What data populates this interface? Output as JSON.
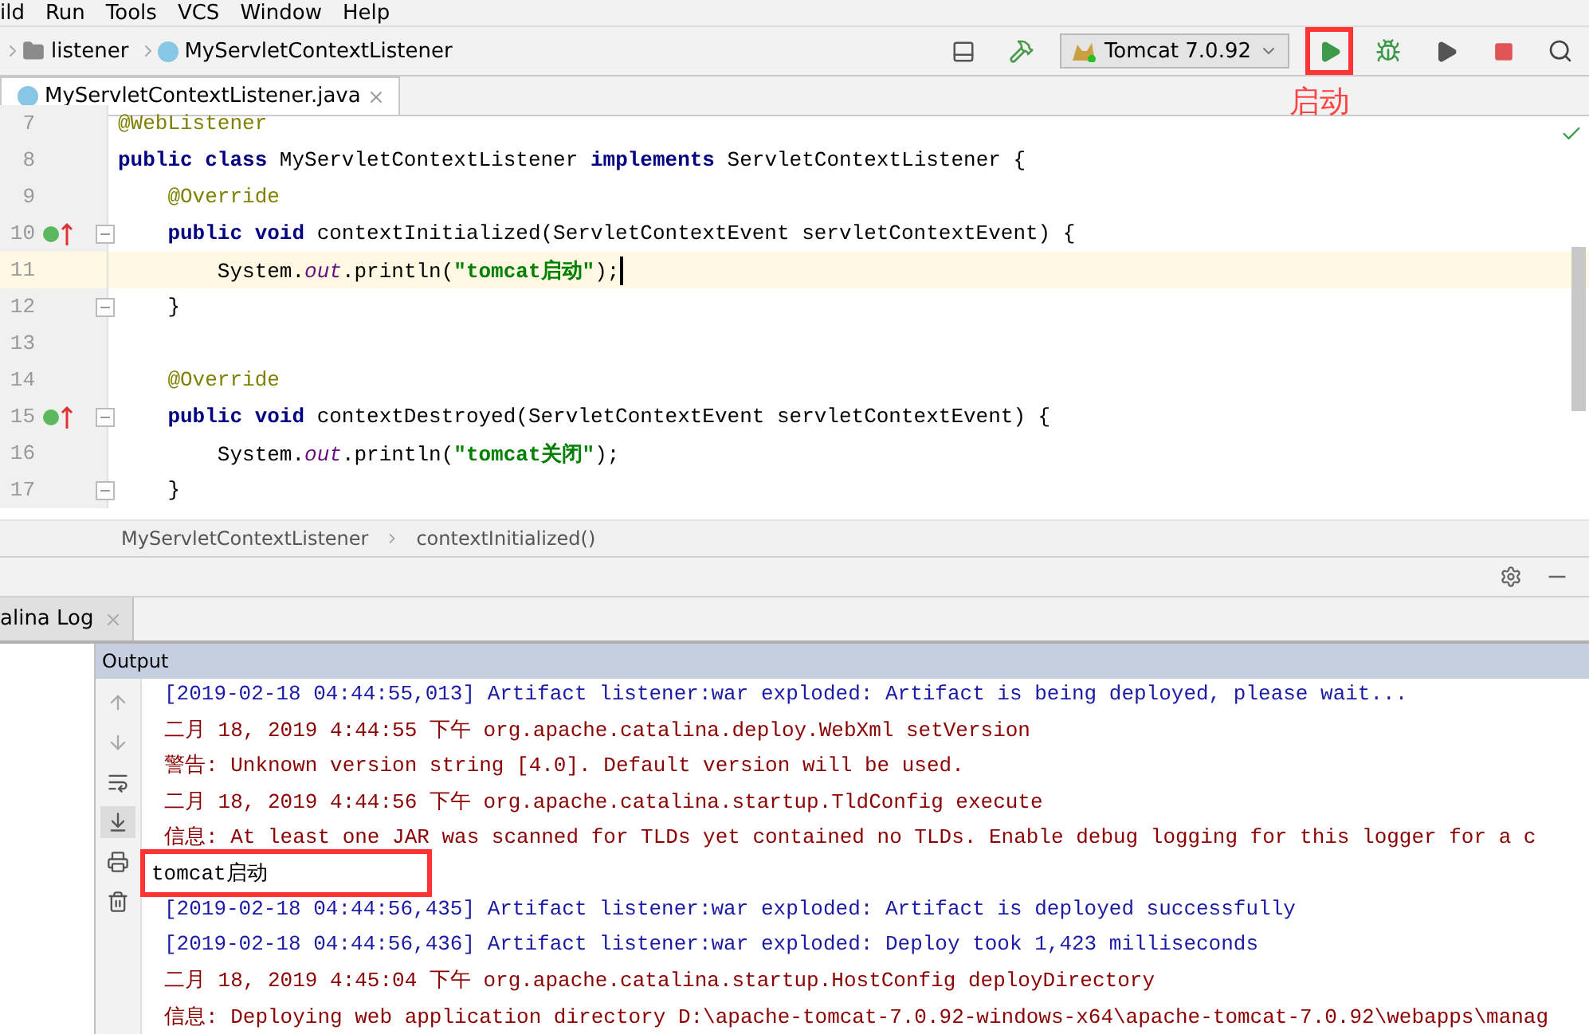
{
  "menu_bar": [
    "ild",
    "Run",
    "Tools",
    "VCS",
    "Window",
    "Help"
  ],
  "nav_bar": {
    "crumbs": [
      {
        "label": "listener",
        "kind": "folder"
      },
      {
        "label": "MyServletContextListener",
        "kind": "class"
      }
    ],
    "run_config": "Tomcat 7.0.92",
    "run_button": {
      "highlighted": true,
      "callout": "启动"
    }
  },
  "editor_tabs": [
    {
      "label": "MyServletContextListener.java",
      "selected": true
    }
  ],
  "code_lines": [
    {
      "number": "7",
      "current": false,
      "override_marker": false,
      "fold": false,
      "segments": [
        {
          "kind": "annotation",
          "text": "@WebListener"
        }
      ]
    },
    {
      "number": "8",
      "current": false,
      "override_marker": false,
      "fold": false,
      "segments": [
        {
          "kind": "keyword",
          "text": "public class "
        },
        {
          "kind": "plain",
          "text": "MyServletContextListener "
        },
        {
          "kind": "keyword",
          "text": "implements "
        },
        {
          "kind": "plain",
          "text": "ServletContextListener {"
        }
      ]
    },
    {
      "number": "9",
      "current": false,
      "override_marker": false,
      "fold": false,
      "segments": [
        {
          "kind": "annotation",
          "text": "    @Override"
        }
      ]
    },
    {
      "number": "10",
      "current": false,
      "override_marker": true,
      "fold": true,
      "segments": [
        {
          "kind": "keyword",
          "text": "    public void "
        },
        {
          "kind": "plain",
          "text": "contextInitialized(ServletContextEvent servletContextEvent) {"
        }
      ]
    },
    {
      "number": "11",
      "current": true,
      "override_marker": false,
      "fold": false,
      "segments": [
        {
          "kind": "plain",
          "text": "        System."
        },
        {
          "kind": "static",
          "text": "out"
        },
        {
          "kind": "plain",
          "text": ".println("
        },
        {
          "kind": "string",
          "text": "\"tomcat启动\""
        },
        {
          "kind": "plain",
          "text": ");"
        }
      ]
    },
    {
      "number": "12",
      "current": false,
      "override_marker": false,
      "fold": true,
      "segments": [
        {
          "kind": "plain",
          "text": "    }"
        }
      ]
    },
    {
      "number": "13",
      "current": false,
      "override_marker": false,
      "fold": false
    },
    {
      "number": "14",
      "current": false,
      "override_marker": false,
      "fold": false,
      "segments": [
        {
          "kind": "annotation",
          "text": "    @Override"
        }
      ]
    },
    {
      "number": "15",
      "current": false,
      "override_marker": true,
      "fold": true,
      "segments": [
        {
          "kind": "keyword",
          "text": "    public void "
        },
        {
          "kind": "plain",
          "text": "contextDestroyed(ServletContextEvent servletContextEvent) {"
        }
      ]
    },
    {
      "number": "16",
      "current": false,
      "override_marker": false,
      "fold": false,
      "segments": [
        {
          "kind": "plain",
          "text": "        System."
        },
        {
          "kind": "static",
          "text": "out"
        },
        {
          "kind": "plain",
          "text": ".println("
        },
        {
          "kind": "string",
          "text": "\"tomcat关闭\""
        },
        {
          "kind": "plain",
          "text": ");"
        }
      ]
    },
    {
      "number": "17",
      "current": false,
      "override_marker": false,
      "fold": true,
      "segments": [
        {
          "kind": "plain",
          "text": "    }"
        }
      ]
    }
  ],
  "editor_breadcrumbs": [
    "MyServletContextListener",
    "contextInitialized()"
  ],
  "tool_tabs": [
    {
      "label": "alina Log",
      "selected": true
    }
  ],
  "console": {
    "title": "Output",
    "lines": [
      {
        "kind": "system",
        "highlighted": false,
        "text": "[2019-02-18 04:44:55,013] Artifact listener:war exploded: Artifact is being deployed, please wait..."
      },
      {
        "kind": "error",
        "highlighted": false,
        "text": "二月 18, 2019 4:44:55 下午 org.apache.catalina.deploy.WebXml setVersion"
      },
      {
        "kind": "error",
        "highlighted": false,
        "text": "警告: Unknown version string [4.0]. Default version will be used."
      },
      {
        "kind": "error",
        "highlighted": false,
        "text": "二月 18, 2019 4:44:56 下午 org.apache.catalina.startup.TldConfig execute"
      },
      {
        "kind": "error",
        "highlighted": false,
        "text": "信息: At least one JAR was scanned for TLDs yet contained no TLDs. Enable debug logging for this logger for a c"
      },
      {
        "kind": "output",
        "highlighted": true,
        "text": "tomcat启动"
      },
      {
        "kind": "system",
        "highlighted": false,
        "text": "[2019-02-18 04:44:56,435] Artifact listener:war exploded: Artifact is deployed successfully"
      },
      {
        "kind": "system",
        "highlighted": false,
        "text": "[2019-02-18 04:44:56,436] Artifact listener:war exploded: Deploy took 1,423 milliseconds"
      },
      {
        "kind": "error",
        "highlighted": false,
        "text": "二月 18, 2019 4:45:04 下午 org.apache.catalina.startup.HostConfig deployDirectory"
      },
      {
        "kind": "error",
        "highlighted": false,
        "text": "信息: Deploying web application directory D:\\apache-tomcat-7.0.92-windows-x64\\apache-tomcat-7.0.92\\webapps\\manag"
      }
    ]
  }
}
